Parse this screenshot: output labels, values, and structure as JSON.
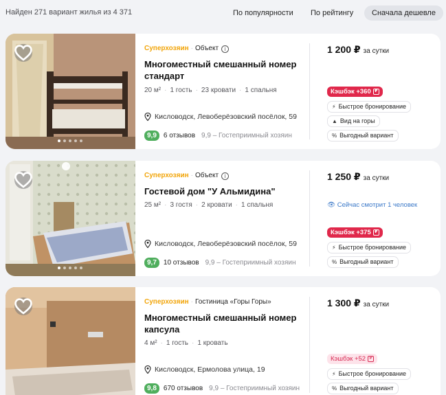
{
  "topbar": {
    "found_text": "Найден 271 вариант жилья из 4 371",
    "sort_options": [
      "По популярности",
      "По рейтингу",
      "Сначала дешевле"
    ],
    "active_sort": "Сначала дешевле"
  },
  "listings": [
    {
      "badge": "Суперхозяин",
      "type": "Объект",
      "title": "Многоместный смешанный номер стандарт",
      "specs": [
        "20 м²",
        "1 гость",
        "23 кровати",
        "1 спальня"
      ],
      "address": "Кисловодск, Левоберёзовский посёлок, 59",
      "score": "9,9",
      "reviews": "6 отзывов",
      "host_note": "9,9 – Гостеприимный хозяин",
      "price": "1 200 ₽",
      "per": "за сутки",
      "viewing": "",
      "cashback": "Кэшбэк +360",
      "features": [
        "Быстрое бронирование",
        "Вид на горы",
        "Выгодный вариант"
      ]
    },
    {
      "badge": "Суперхозяин",
      "type": "Объект",
      "title": "Гостевой дом \"У Альмидина\"",
      "specs": [
        "25 м²",
        "3 гостя",
        "2 кровати",
        "1 спальня"
      ],
      "address": "Кисловодск, Левоберёзовский посёлок, 59",
      "score": "9,7",
      "reviews": "10 отзывов",
      "host_note": "9,9 – Гостеприимный хозяин",
      "price": "1 250 ₽",
      "per": "за сутки",
      "viewing": "Сейчас смотрит 1 человек",
      "cashback": "Кэшбэк +375",
      "features": [
        "Быстрое бронирование",
        "Выгодный вариант"
      ]
    },
    {
      "badge": "Суперхозяин",
      "type": "Гостиница «Горы Горы»",
      "title": "Многоместный смешанный номер капсула",
      "specs": [
        "4 м²",
        "1 гость",
        "1 кровать"
      ],
      "address": "Кисловодск, Ермолова улица, 19",
      "score": "9,8",
      "reviews": "670 отзывов",
      "host_note": "9,9 – Гостеприимный хозяин",
      "price": "1 300 ₽",
      "per": "за сутки",
      "viewing": "",
      "cashback": "Кэшбэк +52",
      "features": [
        "Быстрое бронирование",
        "Выгодный вариант"
      ]
    }
  ],
  "feature_icons": {
    "Быстрое бронирование": "lightning-icon",
    "Вид на горы": "mountain-icon",
    "Выгодный вариант": "percent-icon"
  },
  "colors": {
    "superhost": "#f2a50a",
    "score_green": "#4fae5d",
    "cashback_red": "#e0284b",
    "viewing_blue": "#3a78c8"
  }
}
